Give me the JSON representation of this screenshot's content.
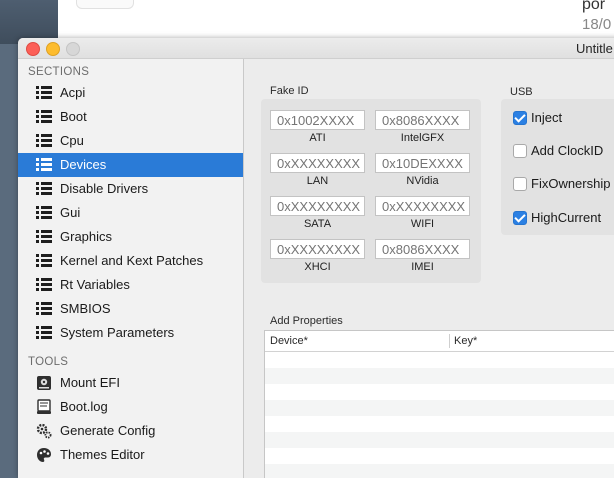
{
  "background": {
    "text_top": "por",
    "text_second": "18/0"
  },
  "window": {
    "title": "Untitle"
  },
  "sidebar": {
    "sections_label": "SECTIONS",
    "tools_label": "TOOLS",
    "sections": [
      {
        "label": "Acpi"
      },
      {
        "label": "Boot"
      },
      {
        "label": "Cpu"
      },
      {
        "label": "Devices",
        "selected": true
      },
      {
        "label": "Disable Drivers"
      },
      {
        "label": "Gui"
      },
      {
        "label": "Graphics"
      },
      {
        "label": "Kernel and Kext Patches"
      },
      {
        "label": "Rt Variables"
      },
      {
        "label": "SMBIOS"
      },
      {
        "label": "System Parameters"
      }
    ],
    "tools": [
      {
        "label": "Mount EFI",
        "icon": "disk-icon"
      },
      {
        "label": "Boot.log",
        "icon": "log-icon"
      },
      {
        "label": "Generate Config",
        "icon": "gear-icon"
      },
      {
        "label": "Themes Editor",
        "icon": "palette-icon"
      }
    ]
  },
  "fake_id": {
    "title": "Fake ID",
    "fields": [
      {
        "placeholder": "0x1002XXXX",
        "label": "ATI"
      },
      {
        "placeholder": "0x8086XXXX",
        "label": "IntelGFX"
      },
      {
        "placeholder": "0xXXXXXXXX",
        "label": "LAN"
      },
      {
        "placeholder": "0x10DEXXXX",
        "label": "NVidia"
      },
      {
        "placeholder": "0xXXXXXXXX",
        "label": "SATA"
      },
      {
        "placeholder": "0xXXXXXXXX",
        "label": "WIFI"
      },
      {
        "placeholder": "0xXXXXXXXX",
        "label": "XHCI"
      },
      {
        "placeholder": "0x8086XXXX",
        "label": "IMEI"
      }
    ]
  },
  "usb": {
    "title": "USB",
    "options": [
      {
        "label": "Inject",
        "checked": true
      },
      {
        "label": "Add ClockID",
        "checked": false
      },
      {
        "label": "FixOwnership",
        "checked": false
      },
      {
        "label": "HighCurrent",
        "checked": true
      }
    ]
  },
  "add_properties": {
    "title": "Add Properties",
    "columns": [
      "Device*",
      "Key*"
    ]
  }
}
